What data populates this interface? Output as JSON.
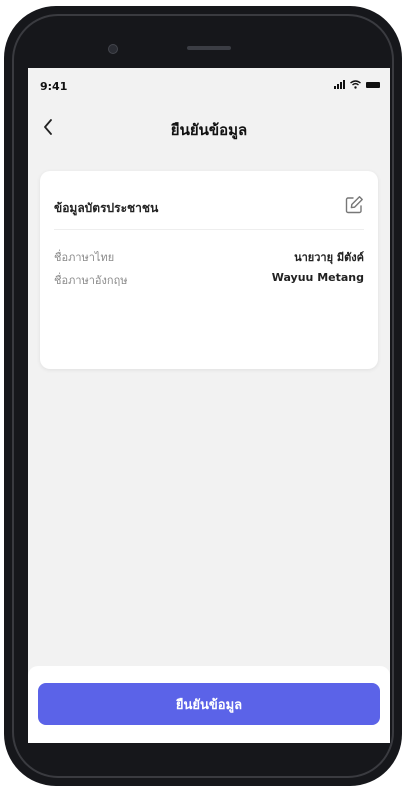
{
  "status_bar": {
    "time": "9:41",
    "icons": [
      "signal-icon",
      "wifi-icon",
      "battery-icon"
    ]
  },
  "nav": {
    "back_icon": "chevron-left-icon",
    "title": "ยืนยันข้อมูล"
  },
  "card": {
    "title": "ข้อมูลบัตรประชาชน",
    "edit_icon": "edit-icon",
    "rows": [
      {
        "label": "ชื่อภาษาไทย",
        "value": "นายวายุ มีตังค์"
      },
      {
        "label": "ชื่อภาษาอังกฤษ",
        "value": "Wayuu Metang"
      }
    ]
  },
  "footer": {
    "confirm_label": "ยืนยันข้อมูล"
  },
  "colors": {
    "accent": "#5b63e8",
    "screen_bg": "#f2f2f2",
    "card_bg": "#ffffff",
    "phone_frame": "#16171b"
  }
}
